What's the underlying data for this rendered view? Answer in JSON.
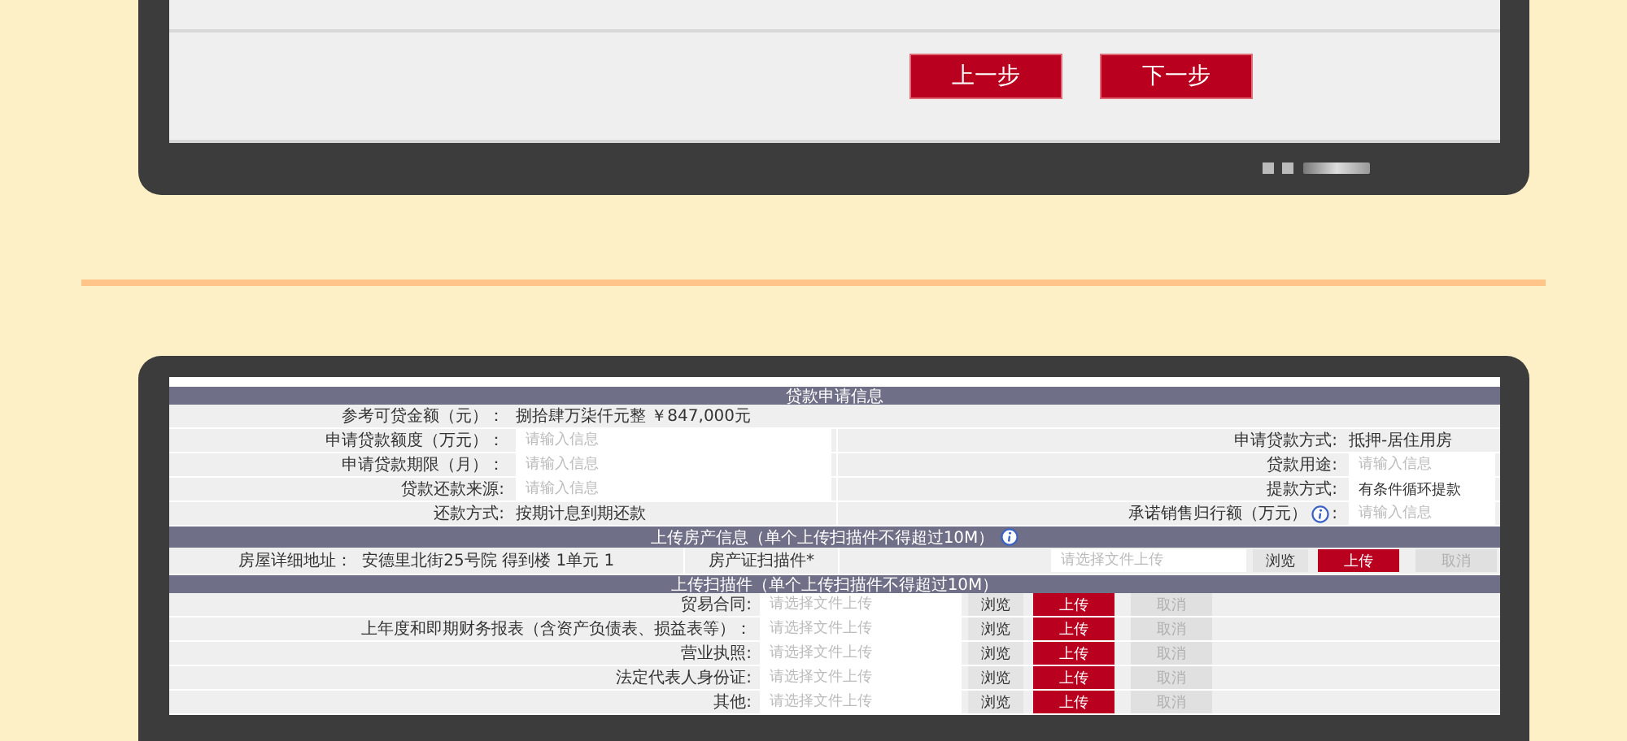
{
  "step_panel": {
    "buttons": [
      {
        "label": "上一步"
      },
      {
        "label": "下一步"
      }
    ]
  },
  "loan_form": {
    "title": "贷款申请信息",
    "rows": [
      {
        "left": {
          "label": "参考可贷金额（元）：",
          "kind": "text",
          "value": "捌拾肆万柒仟元整 ￥847,000元"
        }
      },
      {
        "left": {
          "label": "申请贷款额度（万元）：",
          "kind": "input",
          "placeholder": "请输入信息"
        },
        "right": {
          "label": "申请贷款方式:",
          "kind": "text",
          "value": "抵押-居住用房"
        }
      },
      {
        "left": {
          "label": "申请贷款期限（月）：",
          "kind": "input",
          "placeholder": "请输入信息"
        },
        "right": {
          "label": "贷款用途:",
          "kind": "input",
          "placeholder": "请输入信息"
        }
      },
      {
        "left": {
          "label": "贷款还款来源:",
          "kind": "input",
          "placeholder": "请输入信息"
        },
        "right": {
          "label": "提款方式:",
          "kind": "input",
          "value": "有条件循环提款"
        }
      },
      {
        "left": {
          "label": "还款方式:",
          "kind": "text",
          "value": "按期计息到期还款"
        },
        "right": {
          "label": "承诺销售归行额（万元）",
          "hint_icon": true,
          "label_end": ":",
          "kind": "input",
          "placeholder": "请输入信息"
        }
      }
    ]
  },
  "property_section": {
    "title": "上传房产信息（单个上传扫描件不得超过10M）",
    "hint_icon": true,
    "address_label": "房屋详细地址：",
    "address": "安德里北街25号院 得到楼 1单元 1",
    "file_label": "房产证扫描件*",
    "placeholder": "请选择文件上传",
    "buttons": [
      {
        "kind": "browse",
        "label": "浏览",
        "disabled": false
      },
      {
        "kind": "upload",
        "label": "上传",
        "disabled": false
      },
      {
        "kind": "cancel",
        "label": "取消",
        "disabled": true
      }
    ]
  },
  "scan_section": {
    "title": "上传扫描件（单个上传扫描件不得超过10M）",
    "rows": [
      {
        "label": "贸易合同:",
        "placeholder": "请选择文件上传",
        "buttons": [
          {
            "kind": "browse",
            "label": "浏览",
            "disabled": false
          },
          {
            "kind": "upload",
            "label": "上传",
            "disabled": false
          },
          {
            "kind": "cancel",
            "label": "取消",
            "disabled": true
          }
        ]
      },
      {
        "label": "上年度和即期财务报表（含资产负债表、损益表等）：",
        "placeholder": "请选择文件上传",
        "buttons": [
          {
            "kind": "browse",
            "label": "浏览",
            "disabled": false
          },
          {
            "kind": "upload",
            "label": "上传",
            "disabled": false
          },
          {
            "kind": "cancel",
            "label": "取消",
            "disabled": true
          }
        ]
      },
      {
        "label": "营业执照:",
        "placeholder": "请选择文件上传",
        "buttons": [
          {
            "kind": "browse",
            "label": "浏览",
            "disabled": false
          },
          {
            "kind": "upload",
            "label": "上传",
            "disabled": false
          },
          {
            "kind": "cancel",
            "label": "取消",
            "disabled": true
          }
        ]
      },
      {
        "label": "法定代表人身份证:",
        "placeholder": "请选择文件上传",
        "buttons": [
          {
            "kind": "browse",
            "label": "浏览",
            "disabled": false
          },
          {
            "kind": "upload",
            "label": "上传",
            "disabled": false
          },
          {
            "kind": "cancel",
            "label": "取消",
            "disabled": true
          }
        ]
      },
      {
        "label": "其他:",
        "placeholder": "请选择文件上传",
        "buttons": [
          {
            "kind": "browse",
            "label": "浏览",
            "disabled": false
          },
          {
            "kind": "upload",
            "label": "上传",
            "disabled": false
          },
          {
            "kind": "cancel",
            "label": "取消",
            "disabled": true
          }
        ]
      }
    ]
  }
}
